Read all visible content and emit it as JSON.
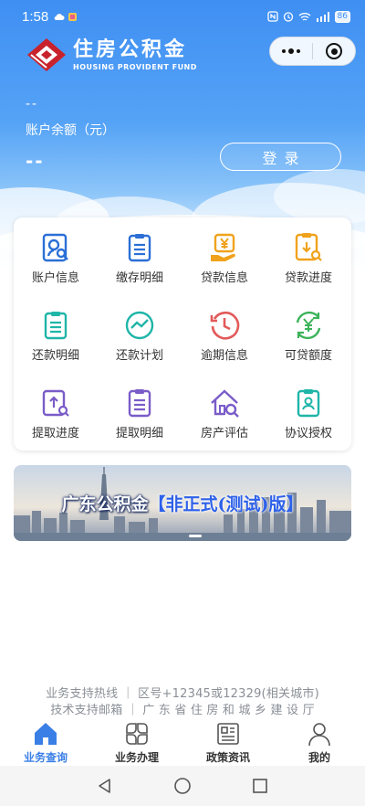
{
  "status_bar": {
    "time": "1:58",
    "battery": "86"
  },
  "brand": {
    "name_cn": "住房公积金",
    "name_en": "HOUSING PROVIDENT FUND"
  },
  "capsule": {
    "more_icon": "more-dots",
    "close_icon": "target-close"
  },
  "account": {
    "id_placeholder": "--",
    "balance_label": "账户余额（元）",
    "balance_value": "--",
    "login_label": "登录"
  },
  "services": [
    {
      "label": "账户信息",
      "icon": "account-search",
      "color": "#2b6fd6"
    },
    {
      "label": "缴存明细",
      "icon": "document-list",
      "color": "#2b6fd6"
    },
    {
      "label": "贷款信息",
      "icon": "yuan-hand",
      "color": "#f0a21c"
    },
    {
      "label": "贷款进度",
      "icon": "download-doc",
      "color": "#f0a21c"
    },
    {
      "label": "还款明细",
      "icon": "clipboard-list",
      "color": "#1fb5a8"
    },
    {
      "label": "还款计划",
      "icon": "trend-circle",
      "color": "#1fb5a8"
    },
    {
      "label": "逾期信息",
      "icon": "clock-history",
      "color": "#e25a5a"
    },
    {
      "label": "可贷额度",
      "icon": "yuan-cycle",
      "color": "#3cb35a"
    },
    {
      "label": "提取进度",
      "icon": "upload-doc",
      "color": "#7a5cc8"
    },
    {
      "label": "提取明细",
      "icon": "document-lines",
      "color": "#7a5cc8"
    },
    {
      "label": "房产评估",
      "icon": "house-search",
      "color": "#7a5cc8"
    },
    {
      "label": "协议授权",
      "icon": "clipboard-check",
      "color": "#1fb5a8"
    }
  ],
  "banner": {
    "title_main": "广东公积金",
    "title_highlight": "【非正式(测试)版】"
  },
  "footer": {
    "line1": "业务支持热线 ｜  区号+12345或12329(相关城市)",
    "line2": "技术支持邮箱 ｜ 广 东 省 住 房 和 城 乡 建 设 厅"
  },
  "tabs": [
    {
      "label": "业务查询",
      "icon": "home-icon",
      "active": true
    },
    {
      "label": "业务办理",
      "icon": "grid-flower-icon",
      "active": false
    },
    {
      "label": "政策资讯",
      "icon": "newspaper-icon",
      "active": false
    },
    {
      "label": "我的",
      "icon": "person-icon",
      "active": false
    }
  ],
  "colors": {
    "accent": "#3a7fe6",
    "hero_top": "#3f8ff3"
  }
}
